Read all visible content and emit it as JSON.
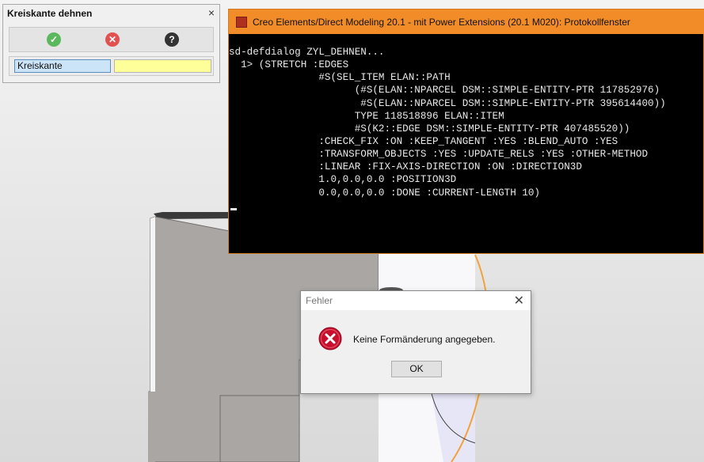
{
  "stretch_dialog": {
    "title": "Kreiskante dehnen",
    "close_glyph": "×",
    "toolbar": {
      "ok_icon": "checkmark-icon",
      "cancel_icon": "cancel-x-icon",
      "help_icon": "help-question-icon",
      "ok_color": "#5cb85c",
      "cancel_color": "#e25050",
      "help_color": "#333333"
    },
    "field_label": "Kreiskante",
    "field_value": ""
  },
  "protocol_window": {
    "title": "Creo Elements/Direct Modeling 20.1 - mit Power Extensions (20.1 M020): Protokollfenster",
    "titlebar_color": "#f28c28",
    "lines": [
      "sd-defdialog ZYL_DEHNEN...",
      "  1> (STRETCH :EDGES",
      "               #S(SEL_ITEM ELAN::PATH",
      "                     (#S(ELAN::NPARCEL DSM::SIMPLE-ENTITY-PTR 117852976)",
      "                      #S(ELAN::NPARCEL DSM::SIMPLE-ENTITY-PTR 395614400))",
      "                     TYPE 118518896 ELAN::ITEM",
      "                     #S(K2::EDGE DSM::SIMPLE-ENTITY-PTR 407485520))",
      "               :CHECK_FIX :ON :KEEP_TANGENT :YES :BLEND_AUTO :YES",
      "               :TRANSFORM_OBJECTS :YES :UPDATE_RELS :YES :OTHER-METHOD",
      "               :LINEAR :FIX-AXIS-DIRECTION :ON :DIRECTION3D",
      "               1.0,0.0,0.0 :POSITION3D",
      "               0.0,0.0,0.0 :DONE :CURRENT-LENGTH 10)"
    ]
  },
  "error_dialog": {
    "title": "Fehler",
    "close_glyph": "✕",
    "message": "Keine Formänderung angegeben.",
    "ok_label": "OK",
    "icon": "error-icon"
  }
}
